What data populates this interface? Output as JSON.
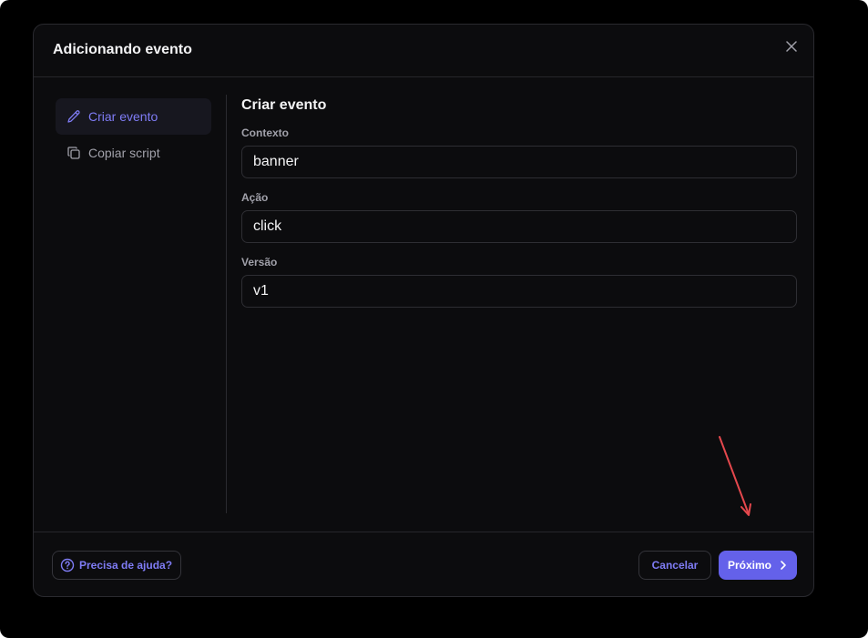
{
  "modal": {
    "title": "Adicionando evento",
    "close_icon": "close-icon"
  },
  "sidebar": {
    "items": [
      {
        "label": "Criar evento",
        "icon": "pencil-icon",
        "active": true
      },
      {
        "label": "Copiar script",
        "icon": "copy-icon",
        "active": false
      }
    ]
  },
  "form": {
    "title": "Criar evento",
    "fields": [
      {
        "label": "Contexto",
        "value": "banner"
      },
      {
        "label": "Ação",
        "value": "click"
      },
      {
        "label": "Versão",
        "value": "v1"
      }
    ]
  },
  "footer": {
    "help_label": "Precisa de ajuda?",
    "help_icon": "question-circle-icon",
    "cancel_label": "Cancelar",
    "next_label": "Próximo",
    "next_icon": "chevron-right-icon"
  },
  "colors": {
    "accent": "#6461ea",
    "accent_text": "#7f7cf5",
    "annotation": "#e5484d"
  }
}
